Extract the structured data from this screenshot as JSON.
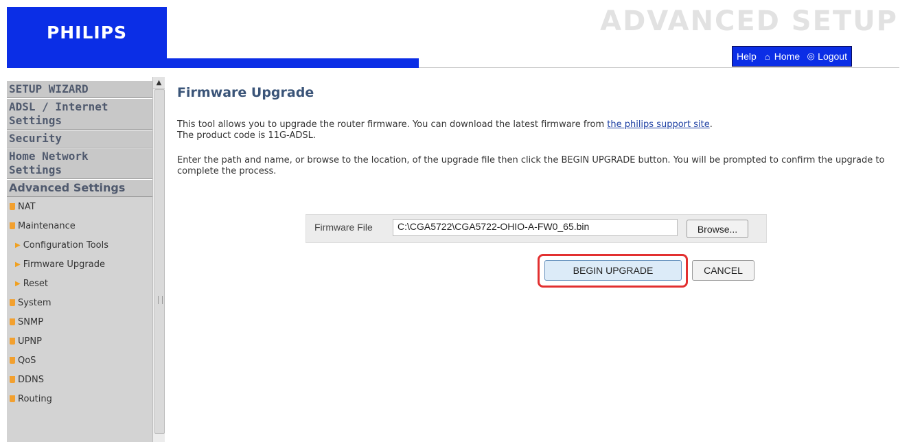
{
  "header": {
    "logo": "PHILIPS",
    "title": "ADVANCED SETUP",
    "links": {
      "help": "Help",
      "home": "Home",
      "logout": "Logout"
    }
  },
  "sidebar": {
    "setup_wizard": "SETUP WIZARD",
    "adsl_line1": "ADSL / Internet",
    "adsl_line2": "Settings",
    "security": "Security",
    "home_network_line1": "Home Network",
    "home_network_line2": "Settings",
    "advanced_settings": "Advanced Settings",
    "items": [
      {
        "label": "NAT"
      },
      {
        "label": "Maintenance"
      },
      {
        "label": "Configuration Tools"
      },
      {
        "label": "Firmware Upgrade"
      },
      {
        "label": "Reset"
      },
      {
        "label": "System"
      },
      {
        "label": "SNMP"
      },
      {
        "label": "UPNP"
      },
      {
        "label": "QoS"
      },
      {
        "label": "DDNS"
      },
      {
        "label": "Routing"
      }
    ]
  },
  "main": {
    "title": "Firmware Upgrade",
    "para1_before_link": "This tool allows you to upgrade the router firmware. You can download the latest firmware from ",
    "para1_link": "the philips support site",
    "para1_after_link": ".",
    "para1_line2": "The product code is 11G-ADSL.",
    "para2": "Enter the path and name, or browse to the location, of the upgrade file then click the BEGIN UPGRADE button. You will be prompted to confirm the upgrade to complete the process.",
    "firmware_label": "Firmware File",
    "firmware_value": "C:\\CGA5722\\CGA5722-OHIO-A-FW0_65.bin",
    "browse_label": "Browse...",
    "begin_label": "BEGIN UPGRADE",
    "cancel_label": "CANCEL"
  },
  "colors": {
    "brand_blue": "#0b2ee6",
    "title_blue": "#3a5478",
    "highlight_red": "#e23030",
    "bullet_orange": "#f2a02f"
  },
  "icons": [
    "home-icon",
    "logout-icon",
    "scroll-up-arrow-icon",
    "bullet-icon",
    "triangle-bullet-icon"
  ]
}
